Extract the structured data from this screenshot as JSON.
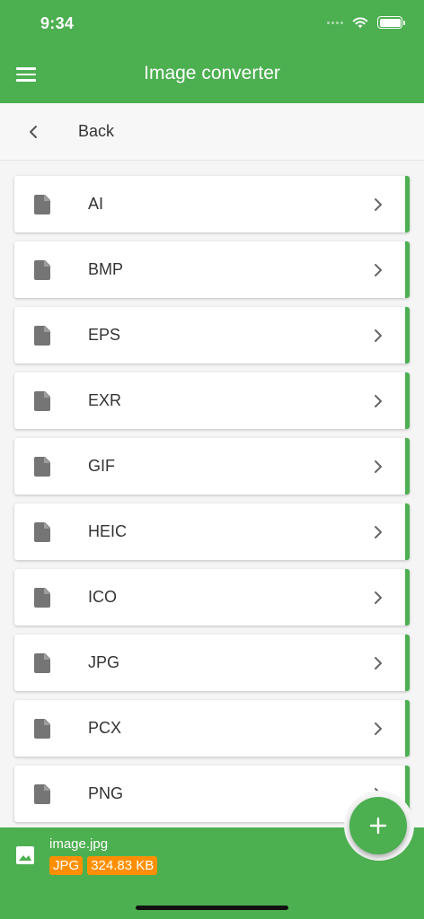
{
  "status_bar": {
    "time": "9:34"
  },
  "header": {
    "title": "Image converter"
  },
  "back": {
    "label": "Back"
  },
  "formats": [
    {
      "label": "AI"
    },
    {
      "label": "BMP"
    },
    {
      "label": "EPS"
    },
    {
      "label": "EXR"
    },
    {
      "label": "GIF"
    },
    {
      "label": "HEIC"
    },
    {
      "label": "ICO"
    },
    {
      "label": "JPG"
    },
    {
      "label": "PCX"
    },
    {
      "label": "PNG"
    }
  ],
  "selected_file": {
    "name": "image.jpg",
    "type": "JPG",
    "size": "324.83 KB"
  },
  "icons": {
    "menu": "menu-icon",
    "back": "chevron-left-icon",
    "file": "file-icon",
    "item_arrow": "chevron-right-icon",
    "image": "image-icon",
    "fab": "plus-icon"
  },
  "colors": {
    "primary": "#4caf50",
    "badge": "#ff8f00",
    "file_icon": "#757575"
  }
}
